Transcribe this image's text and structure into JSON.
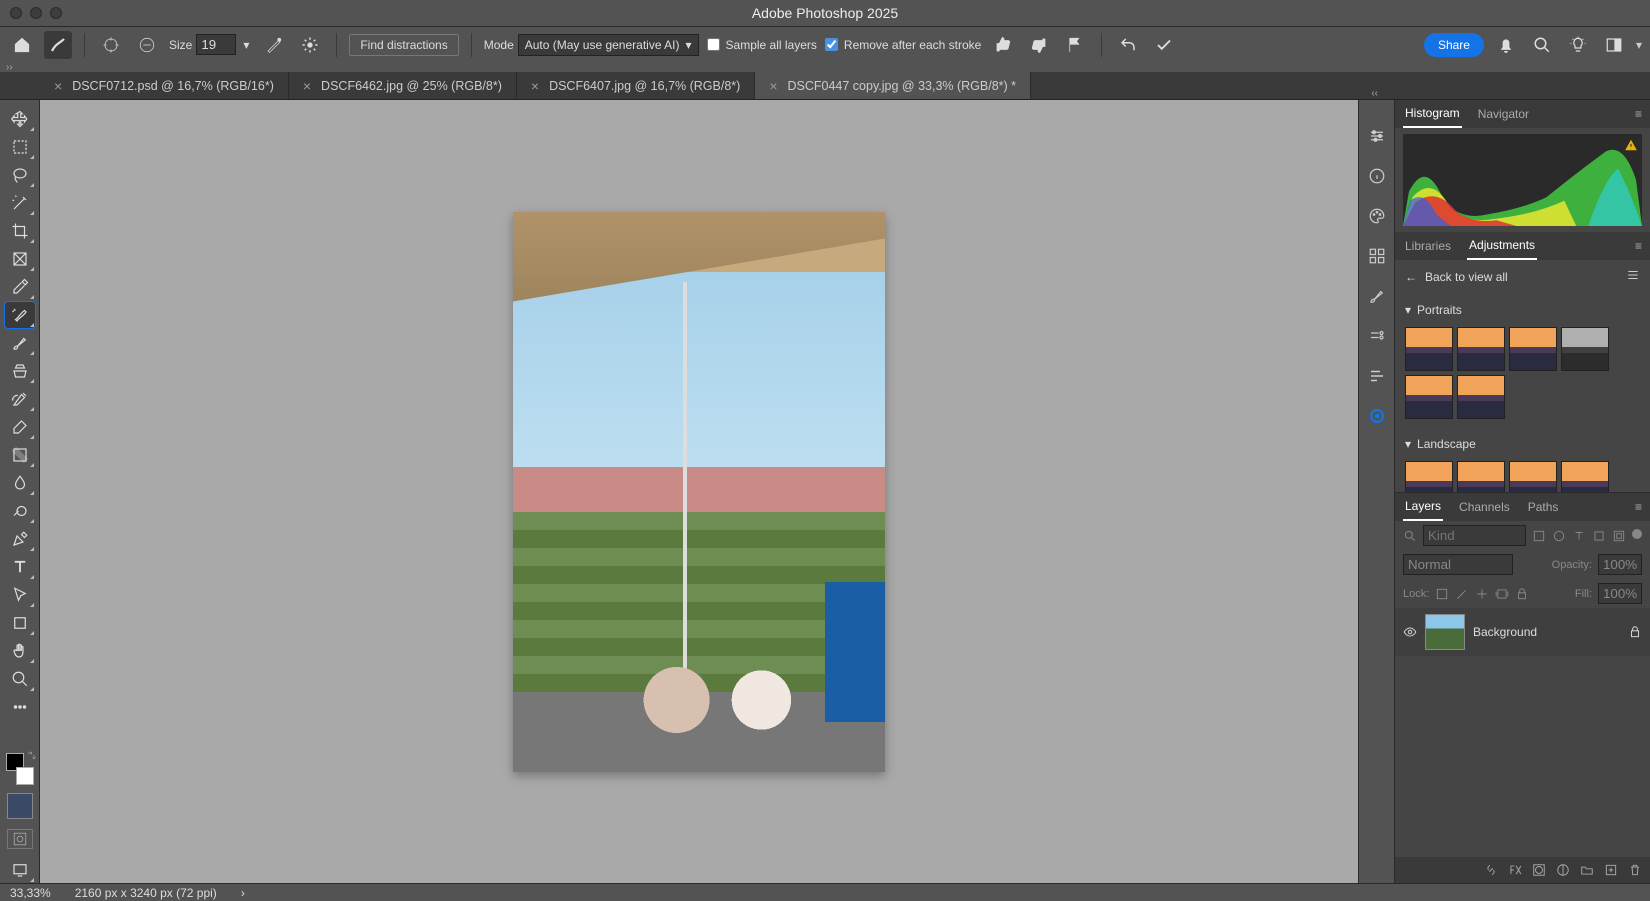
{
  "title": "Adobe Photoshop 2025",
  "options": {
    "size_label": "Size",
    "size_value": "19",
    "find_distractions": "Find distractions",
    "mode_label": "Mode",
    "mode_value": "Auto (May use generative AI)",
    "sample_all": "Sample all layers",
    "remove_after": "Remove after each stroke",
    "share": "Share"
  },
  "tabs": [
    {
      "label": "DSCF0712.psd @ 16,7% (RGB/16*)",
      "active": false
    },
    {
      "label": "DSCF6462.jpg @ 25% (RGB/8*)",
      "active": false
    },
    {
      "label": "DSCF6407.jpg @ 16,7% (RGB/8*)",
      "active": false
    },
    {
      "label": "DSCF0447 copy.jpg @ 33,3% (RGB/8*) *",
      "active": true
    }
  ],
  "panels": {
    "histogram": "Histogram",
    "navigator": "Navigator",
    "libraries": "Libraries",
    "adjustments": "Adjustments",
    "back": "Back to view all",
    "portraits": "Portraits",
    "landscape": "Landscape",
    "layers": "Layers",
    "channels": "Channels",
    "paths": "Paths"
  },
  "layers": {
    "filter_placeholder": "Kind",
    "blend": "Normal",
    "opacity_label": "Opacity:",
    "opacity_value": "100%",
    "lock_label": "Lock:",
    "fill_label": "Fill:",
    "fill_value": "100%",
    "bg_name": "Background"
  },
  "status": {
    "zoom": "33,33%",
    "dims": "2160 px x 3240 px (72 ppi)"
  }
}
